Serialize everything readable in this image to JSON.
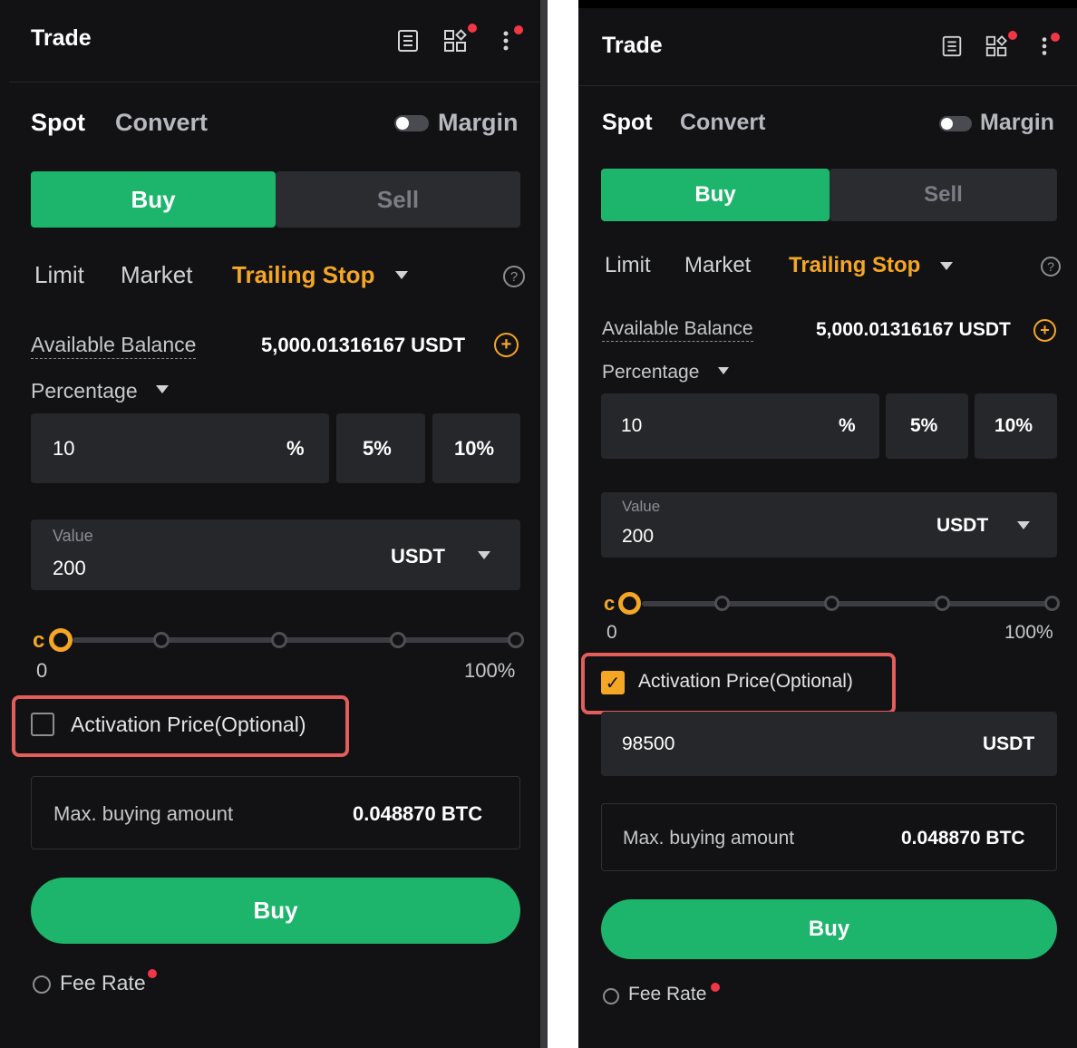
{
  "colors": {
    "background": "#121214",
    "buy_green": "#1db56c",
    "accent_orange": "#f5a623",
    "highlight_red": "#e35d5b",
    "notification_red": "#f23645"
  },
  "panels": [
    {
      "title": "Trade",
      "header_icons": [
        "orders-icon",
        "grid-apps-icon",
        "more-vertical-icon"
      ],
      "tabs": {
        "spot": "Spot",
        "convert": "Convert",
        "margin": "Margin"
      },
      "margin_enabled": false,
      "segment": {
        "buy": "Buy",
        "sell": "Sell",
        "selected": "Buy"
      },
      "order_types": {
        "limit": "Limit",
        "market": "Market",
        "trailing_stop": "Trailing Stop",
        "selected": "Trailing Stop"
      },
      "available_balance": {
        "label": "Available Balance",
        "value": "5,000.01316167 USDT"
      },
      "percentage": {
        "label": "Percentage",
        "input_value": "10",
        "unit": "%",
        "presets": [
          "5%",
          "10%"
        ]
      },
      "value_field": {
        "label": "Value",
        "amount": "200",
        "currency": "USDT"
      },
      "slider": {
        "fraction": 0,
        "min_label": "0",
        "max_label": "100%"
      },
      "activation_price": {
        "label": "Activation Price(Optional)",
        "checked": false
      },
      "max_buying": {
        "label": "Max. buying amount",
        "value": "0.048870 BTC"
      },
      "submit_label": "Buy",
      "fee_rate": "Fee Rate"
    },
    {
      "title": "Trade",
      "header_icons": [
        "orders-icon",
        "grid-apps-icon",
        "more-vertical-icon"
      ],
      "tabs": {
        "spot": "Spot",
        "convert": "Convert",
        "margin": "Margin"
      },
      "margin_enabled": false,
      "segment": {
        "buy": "Buy",
        "sell": "Sell",
        "selected": "Buy"
      },
      "order_types": {
        "limit": "Limit",
        "market": "Market",
        "trailing_stop": "Trailing Stop",
        "selected": "Trailing Stop"
      },
      "available_balance": {
        "label": "Available Balance",
        "value": "5,000.01316167 USDT"
      },
      "percentage": {
        "label": "Percentage",
        "input_value": "10",
        "unit": "%",
        "presets": [
          "5%",
          "10%"
        ]
      },
      "value_field": {
        "label": "Value",
        "amount": "200",
        "currency": "USDT"
      },
      "slider": {
        "fraction": 0,
        "min_label": "0",
        "max_label": "100%"
      },
      "activation_price": {
        "label": "Activation Price(Optional)",
        "checked": true,
        "value": "98500",
        "currency": "USDT"
      },
      "max_buying": {
        "label": "Max. buying amount",
        "value": "0.048870 BTC"
      },
      "submit_label": "Buy",
      "fee_rate": "Fee Rate"
    }
  ]
}
